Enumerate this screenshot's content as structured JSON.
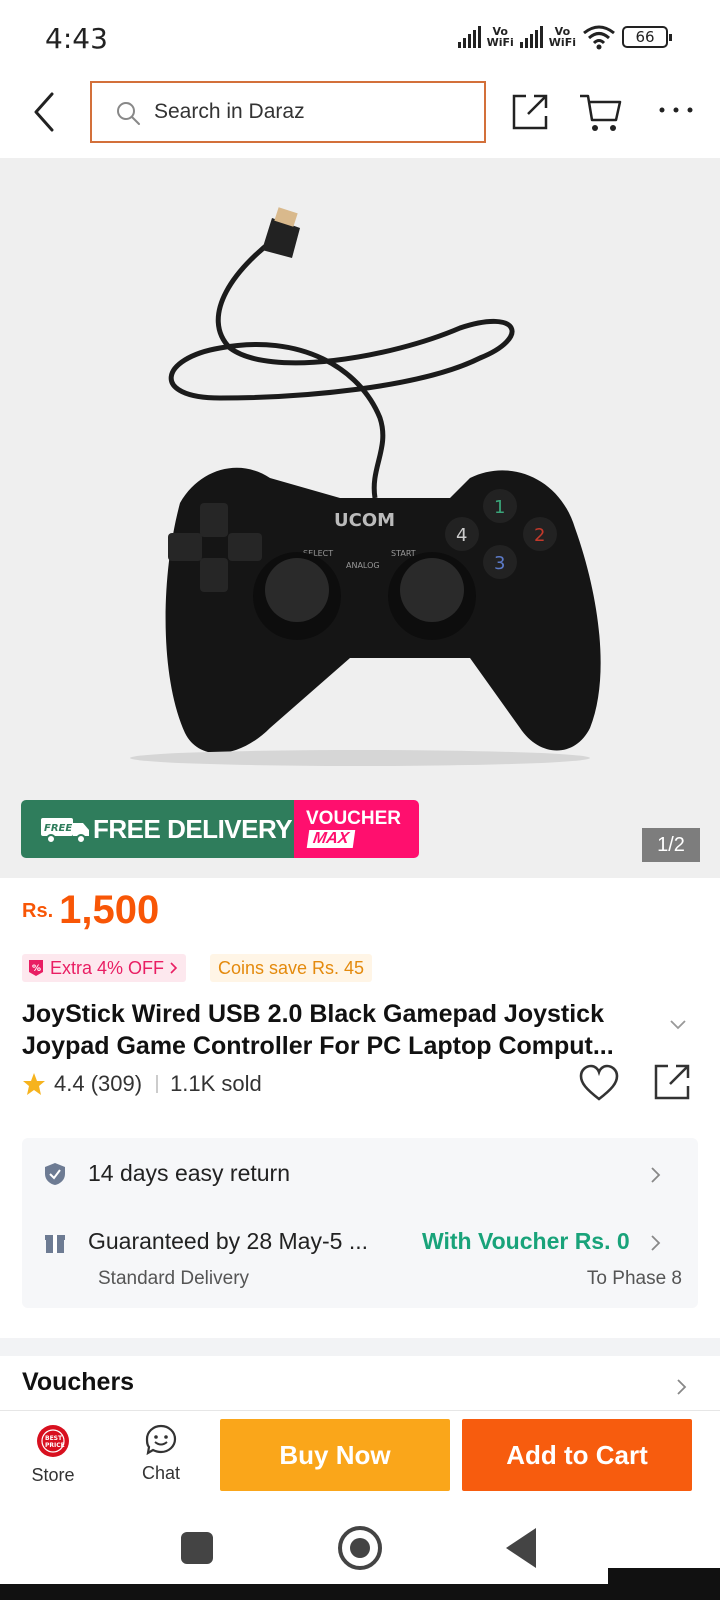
{
  "status_bar": {
    "time": "4:43",
    "sim1": "Vo\nWiFi",
    "sim2": "Vo\nWiFi",
    "battery": "66"
  },
  "header": {
    "search_placeholder": "Search in Daraz"
  },
  "gallery": {
    "badge_free_text": "FREE DELIVERY",
    "badge_free_small": "FREE",
    "badge_voucher_line1": "VOUCHER",
    "badge_voucher_line2": "MAX",
    "page_indicator": "1/2",
    "product_brand_print": "UCOM",
    "pad_labels": {
      "select": "SELECT",
      "start": "START",
      "analog": "ANALOG",
      "b1": "1",
      "b2": "2",
      "b3": "3",
      "b4": "4"
    }
  },
  "product": {
    "price_currency": "Rs.",
    "price_value": "1,500",
    "promo_tag": "Extra 4% OFF",
    "coins_tag": "Coins save Rs. 45",
    "title_line1": "JoyStick Wired USB 2.0 Black Gamepad Joystick",
    "title_line2": "Joypad Game Controller For PC Laptop Comput...",
    "rating": "4.4 (309)",
    "sold": "1.1K sold"
  },
  "service": {
    "return": "14 days easy return",
    "guarantee": "Guaranteed by 28 May-5 ...",
    "voucher": "With Voucher Rs. 0",
    "standard": "Standard Delivery",
    "to": "To Phase 8"
  },
  "vouchers": {
    "title": "Vouchers"
  },
  "actions": {
    "store": "Store",
    "chat": "Chat",
    "buy_now": "Buy Now",
    "add_to_cart": "Add to Cart"
  },
  "colors": {
    "accent_orange": "#f85606",
    "buy_now": "#faa61a",
    "add_to_cart": "#f75c0e",
    "search_border": "#d3703a",
    "free_delivery": "#2f7d5c",
    "voucher_pink": "#ff0f6e",
    "voucher_green": "#19a37a"
  },
  "icons": [
    "back-arrow-icon",
    "search-icon",
    "share-icon",
    "cart-icon",
    "more-icon",
    "star-icon",
    "heart-icon",
    "shield-icon",
    "box-icon",
    "chevron-right-icon",
    "store-icon",
    "chat-icon"
  ]
}
